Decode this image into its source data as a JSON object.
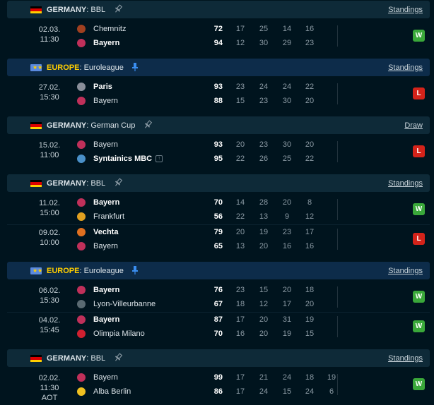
{
  "sections": [
    {
      "country": "GERMANY",
      "competition": "BBL",
      "flag": "de",
      "link": "Standings",
      "matches": [
        {
          "date": "02.03.",
          "time": "11:30",
          "extra": "",
          "home": {
            "name": "Chemnitz",
            "logo_color": "#a04020",
            "winner": false,
            "score": "72",
            "quarters": [
              "17",
              "25",
              "14",
              "16"
            ]
          },
          "away": {
            "name": "Bayern",
            "logo_color": "#c0305a",
            "winner": true,
            "score": "94",
            "quarters": [
              "12",
              "30",
              "29",
              "23"
            ]
          },
          "result": "W"
        }
      ]
    },
    {
      "country": "EUROPE",
      "competition": "Euroleague",
      "flag": "eu",
      "link": "Standings",
      "matches": [
        {
          "date": "27.02.",
          "time": "15:30",
          "extra": "",
          "home": {
            "name": "Paris",
            "logo_color": "#8a8f9a",
            "winner": true,
            "score": "93",
            "quarters": [
              "23",
              "24",
              "24",
              "22"
            ]
          },
          "away": {
            "name": "Bayern",
            "logo_color": "#c0305a",
            "winner": false,
            "score": "88",
            "quarters": [
              "15",
              "23",
              "30",
              "20"
            ]
          },
          "result": "L"
        }
      ]
    },
    {
      "country": "GERMANY",
      "competition": "German Cup",
      "flag": "de",
      "link": "Draw",
      "matches": [
        {
          "date": "15.02.",
          "time": "11:00",
          "extra": "",
          "home": {
            "name": "Bayern",
            "logo_color": "#c0305a",
            "winner": false,
            "score": "93",
            "quarters": [
              "20",
              "23",
              "30",
              "20"
            ]
          },
          "away": {
            "name": "Syntainics MBC",
            "logo_color": "#4a90c8",
            "winner": true,
            "score": "95",
            "quarters": [
              "22",
              "26",
              "25",
              "22"
            ],
            "badge": "↑"
          },
          "result": "L"
        }
      ]
    },
    {
      "country": "GERMANY",
      "competition": "BBL",
      "flag": "de",
      "link": "Standings",
      "matches": [
        {
          "date": "11.02.",
          "time": "15:00",
          "extra": "",
          "home": {
            "name": "Bayern",
            "logo_color": "#c0305a",
            "winner": true,
            "score": "70",
            "quarters": [
              "14",
              "28",
              "20",
              "8"
            ]
          },
          "away": {
            "name": "Frankfurt",
            "logo_color": "#e0a020",
            "winner": false,
            "score": "56",
            "quarters": [
              "22",
              "13",
              "9",
              "12"
            ]
          },
          "result": "W"
        },
        {
          "date": "09.02.",
          "time": "10:00",
          "extra": "",
          "home": {
            "name": "Vechta",
            "logo_color": "#e07020",
            "winner": true,
            "score": "79",
            "quarters": [
              "20",
              "19",
              "23",
              "17"
            ]
          },
          "away": {
            "name": "Bayern",
            "logo_color": "#c0305a",
            "winner": false,
            "score": "65",
            "quarters": [
              "13",
              "20",
              "16",
              "16"
            ]
          },
          "result": "L"
        }
      ]
    },
    {
      "country": "EUROPE",
      "competition": "Euroleague",
      "flag": "eu",
      "link": "Standings",
      "matches": [
        {
          "date": "06.02.",
          "time": "15:30",
          "extra": "",
          "home": {
            "name": "Bayern",
            "logo_color": "#c0305a",
            "winner": true,
            "score": "76",
            "quarters": [
              "23",
              "15",
              "20",
              "18"
            ]
          },
          "away": {
            "name": "Lyon-Villeurbanne",
            "logo_color": "#5a6a72",
            "winner": false,
            "score": "67",
            "quarters": [
              "18",
              "12",
              "17",
              "20"
            ]
          },
          "result": "W"
        },
        {
          "date": "04.02.",
          "time": "15:45",
          "extra": "",
          "home": {
            "name": "Bayern",
            "logo_color": "#c0305a",
            "winner": true,
            "score": "87",
            "quarters": [
              "17",
              "20",
              "31",
              "19"
            ]
          },
          "away": {
            "name": "Olimpia Milano",
            "logo_color": "#d02030",
            "winner": false,
            "score": "70",
            "quarters": [
              "16",
              "20",
              "19",
              "15"
            ]
          },
          "result": "W"
        }
      ]
    },
    {
      "country": "GERMANY",
      "competition": "BBL",
      "flag": "de",
      "link": "Standings",
      "matches": [
        {
          "date": "02.02.",
          "time": "11:30",
          "extra": "AOT",
          "home": {
            "name": "Bayern",
            "logo_color": "#c0305a",
            "winner": false,
            "score": "99",
            "quarters": [
              "17",
              "21",
              "24",
              "18",
              "19"
            ]
          },
          "away": {
            "name": "Alba Berlin",
            "logo_color": "#f0c020",
            "winner": false,
            "score": "86",
            "quarters": [
              "17",
              "24",
              "15",
              "24",
              "6"
            ]
          },
          "result": "W"
        }
      ]
    }
  ]
}
